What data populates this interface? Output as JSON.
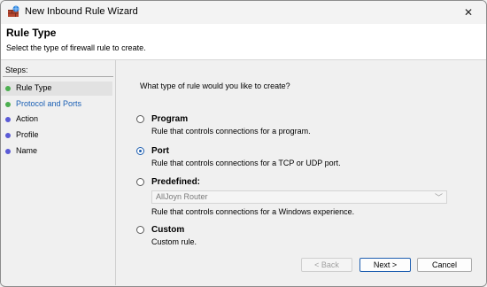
{
  "window": {
    "title": "New Inbound Rule Wizard",
    "close_glyph": "✕"
  },
  "header": {
    "title": "Rule Type",
    "subtitle": "Select the type of firewall rule to create."
  },
  "steps": {
    "label": "Steps:",
    "items": [
      {
        "label": "Rule Type",
        "color": "#4caf50"
      },
      {
        "label": "Protocol and Ports",
        "color": "#4caf50"
      },
      {
        "label": "Action",
        "color": "#5b5bd6"
      },
      {
        "label": "Profile",
        "color": "#5b5bd6"
      },
      {
        "label": "Name",
        "color": "#5b5bd6"
      }
    ]
  },
  "content": {
    "question": "What type of rule would you like to create?",
    "options": [
      {
        "title": "Program",
        "description": "Rule that controls connections for a program.",
        "selected": false
      },
      {
        "title": "Port",
        "description": "Rule that controls connections for a TCP or UDP port.",
        "selected": true
      },
      {
        "title": "Predefined:",
        "description": "Rule that controls connections for a Windows experience.",
        "selected": false
      },
      {
        "title": "Custom",
        "description": "Custom rule.",
        "selected": false
      }
    ],
    "predefined_dropdown": {
      "value": "AllJoyn Router",
      "chevron": "﹀"
    }
  },
  "buttons": {
    "back": "< Back",
    "next": "Next >",
    "cancel": "Cancel"
  }
}
